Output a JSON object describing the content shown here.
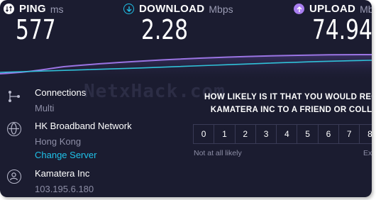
{
  "metrics": [
    {
      "key": "ping",
      "name": "PING",
      "unit": "ms",
      "value": "577",
      "icon": "ping-icon",
      "color": "#ffffff"
    },
    {
      "key": "download",
      "name": "DOWNLOAD",
      "unit": "Mbps",
      "value": "2.28",
      "icon": "download-arrow-icon",
      "color": "#1fc1e8"
    },
    {
      "key": "upload",
      "name": "UPLOAD",
      "unit": "Mbps",
      "value": "74.94",
      "icon": "upload-arrow-icon",
      "color": "#a97ef0"
    }
  ],
  "colors": {
    "download_line": "#30c1d8",
    "upload_line": "#9a74e3",
    "background": "#1b1c30",
    "link": "#1fc1e8"
  },
  "server": {
    "connections_label": "Connections",
    "connections_value": "Multi",
    "isp_name": "HK Broadband Network",
    "isp_location": "Hong Kong",
    "change_server": "Change Server",
    "host_name": "Kamatera Inc",
    "host_ip": "103.195.6.180"
  },
  "watermark": "NetxHack.com",
  "survey": {
    "question_line1": "HOW LIKELY IS IT THAT YOU WOULD RECO",
    "question_line2": "KAMATERA INC TO A FRIEND OR COLLE",
    "scale": [
      "0",
      "1",
      "2",
      "3",
      "4",
      "5",
      "6",
      "7",
      "8"
    ],
    "low_label": "Not at all likely",
    "high_label": "Ext"
  }
}
